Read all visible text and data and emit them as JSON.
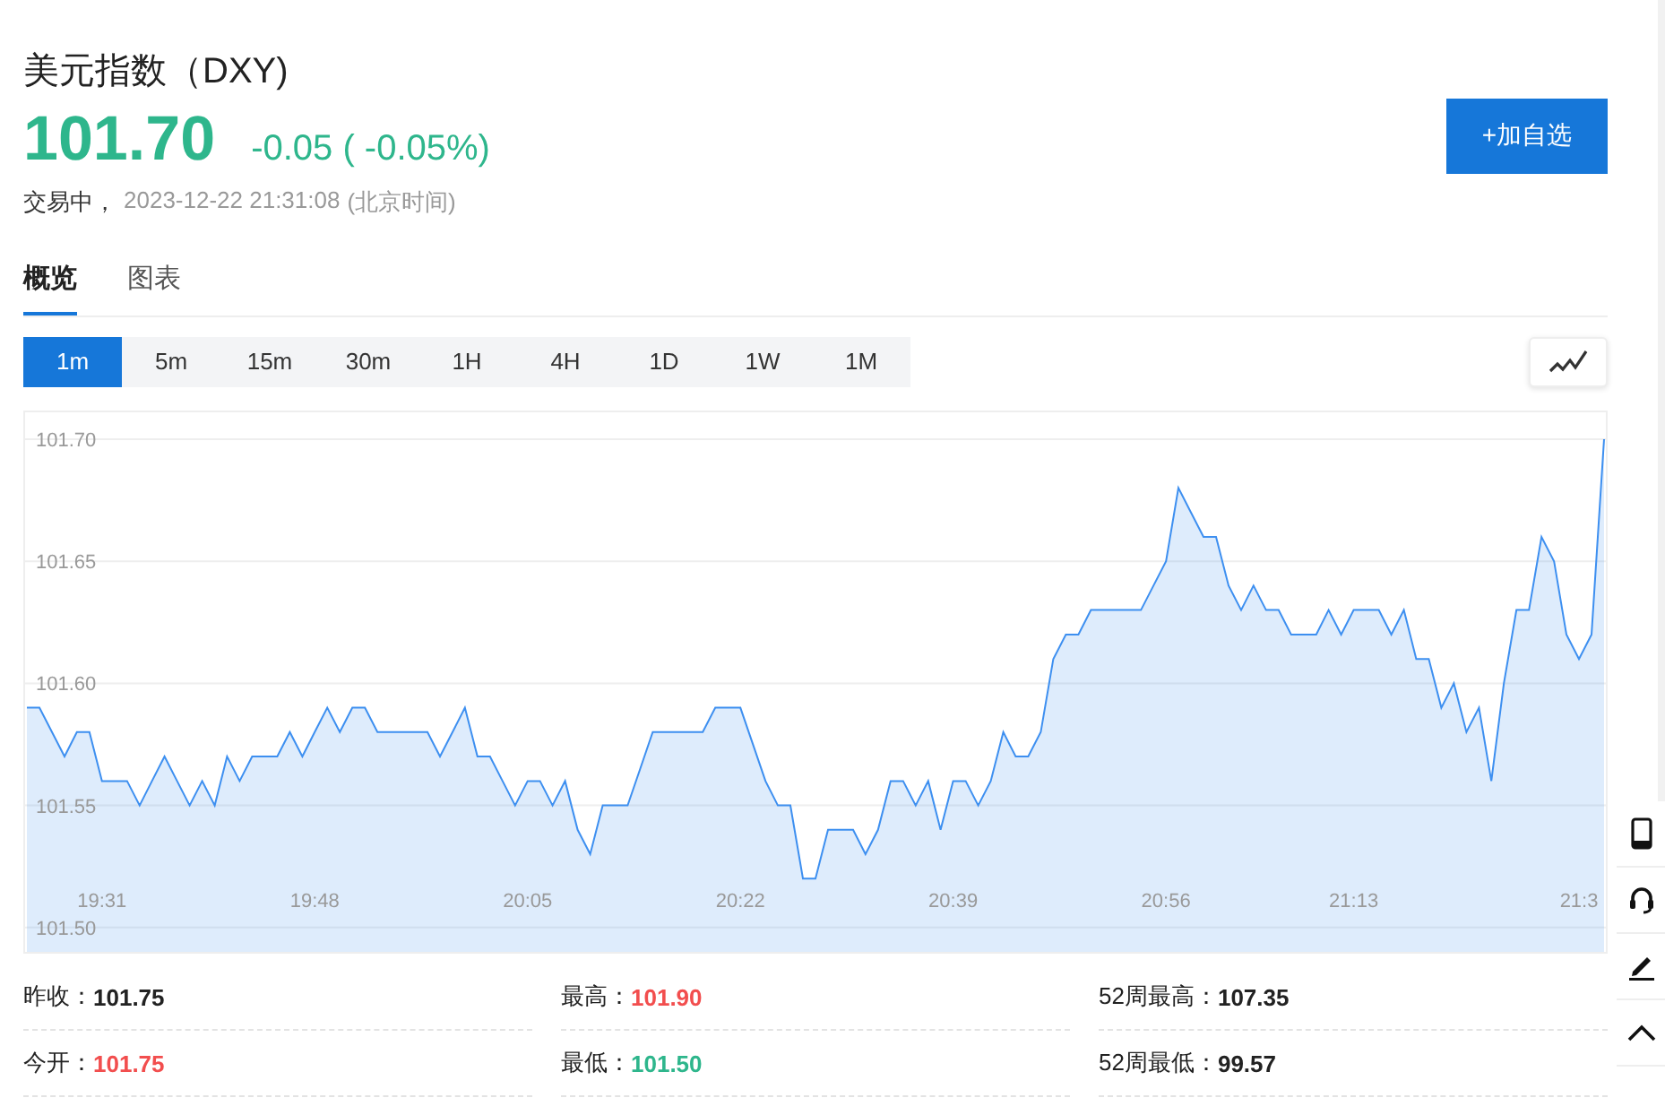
{
  "header": {
    "title": "美元指数（DXY)",
    "price": "101.70",
    "change": "-0.05 ( -0.05%)",
    "status": "交易中，",
    "time": "2023-12-22 21:31:08",
    "timezone": "(北京时间)",
    "watch_button": "+加自选"
  },
  "tabs": [
    {
      "label": "概览",
      "selected": true
    },
    {
      "label": "图表",
      "selected": false
    }
  ],
  "ranges": [
    {
      "label": "1m",
      "selected": true
    },
    {
      "label": "5m",
      "selected": false
    },
    {
      "label": "15m",
      "selected": false
    },
    {
      "label": "30m",
      "selected": false
    },
    {
      "label": "1H",
      "selected": false
    },
    {
      "label": "4H",
      "selected": false
    },
    {
      "label": "1D",
      "selected": false
    },
    {
      "label": "1W",
      "selected": false
    },
    {
      "label": "1M",
      "selected": false
    }
  ],
  "chart": {
    "chart_data": {
      "type": "area",
      "categories": [
        null,
        null,
        null,
        null,
        null,
        null,
        "19:31",
        null,
        null,
        null,
        null,
        null,
        null,
        null,
        null,
        null,
        null,
        null,
        null,
        null,
        null,
        null,
        null,
        "19:48",
        null,
        null,
        null,
        null,
        null,
        null,
        null,
        null,
        null,
        null,
        null,
        null,
        null,
        null,
        null,
        null,
        "20:05",
        null,
        null,
        null,
        null,
        null,
        null,
        null,
        null,
        null,
        null,
        null,
        null,
        null,
        null,
        null,
        null,
        "20:22",
        null,
        null,
        null,
        null,
        null,
        null,
        null,
        null,
        null,
        null,
        null,
        null,
        null,
        null,
        null,
        null,
        "20:39",
        null,
        null,
        null,
        null,
        null,
        null,
        null,
        null,
        null,
        null,
        null,
        null,
        null,
        null,
        null,
        null,
        "20:56",
        null,
        null,
        null,
        null,
        null,
        null,
        null,
        null,
        null,
        null,
        null,
        null,
        null,
        null,
        "21:13",
        null,
        null,
        null,
        null,
        null,
        null,
        null,
        null,
        null,
        null,
        null,
        null,
        null,
        null,
        null,
        null,
        null,
        "21:3",
        null,
        null
      ],
      "series": [
        {
          "color": "#3d8ff0",
          "values": [
            101.59,
            101.59,
            101.58,
            101.57,
            101.58,
            101.58,
            101.56,
            101.56,
            101.56,
            101.55,
            101.56,
            101.57,
            101.56,
            101.55,
            101.56,
            101.55,
            101.57,
            101.56,
            101.57,
            101.57,
            101.57,
            101.58,
            101.57,
            101.58,
            101.59,
            101.58,
            101.59,
            101.59,
            101.58,
            101.58,
            101.58,
            101.58,
            101.58,
            101.57,
            101.58,
            101.59,
            101.57,
            101.57,
            101.56,
            101.55,
            101.56,
            101.56,
            101.55,
            101.56,
            101.54,
            101.53,
            101.55,
            101.55,
            101.55,
            101.565,
            101.58,
            101.58,
            101.58,
            101.58,
            101.58,
            101.59,
            101.59,
            101.59,
            101.575,
            101.56,
            101.55,
            101.55,
            101.52,
            101.52,
            101.54,
            101.54,
            101.54,
            101.53,
            101.54,
            101.56,
            101.56,
            101.55,
            101.56,
            101.54,
            101.56,
            101.56,
            101.55,
            101.56,
            101.58,
            101.57,
            101.57,
            101.58,
            101.61,
            101.62,
            101.62,
            101.63,
            101.63,
            101.63,
            101.63,
            101.63,
            101.64,
            101.65,
            101.68,
            101.67,
            101.66,
            101.66,
            101.64,
            101.63,
            101.64,
            101.63,
            101.63,
            101.62,
            101.62,
            101.62,
            101.63,
            101.62,
            101.63,
            101.63,
            101.63,
            101.62,
            101.63,
            101.61,
            101.61,
            101.59,
            101.6,
            101.58,
            101.59,
            101.56,
            101.6,
            101.63,
            101.63,
            101.66,
            101.65,
            101.62,
            101.61,
            101.62,
            101.7
          ]
        }
      ],
      "ylim": [
        101.49,
        101.7
      ],
      "grid": true,
      "yticks": [
        {
          "value": 101.7,
          "label": "101.70"
        },
        {
          "value": 101.65,
          "label": "101.65"
        },
        {
          "value": 101.6,
          "label": "101.60"
        },
        {
          "value": 101.55,
          "label": "101.55"
        },
        {
          "value": 101.5,
          "label": "101.50"
        }
      ]
    }
  },
  "stats": [
    {
      "label": "昨收：",
      "value": "101.75",
      "color": "#222222"
    },
    {
      "label": "最高：",
      "value": "101.90",
      "color": "#f24e4e"
    },
    {
      "label": "52周最高：",
      "value": "107.35",
      "color": "#222222"
    },
    {
      "label": "今开：",
      "value": "101.75",
      "color": "#f24e4e"
    },
    {
      "label": "最低：",
      "value": "101.50",
      "color": "#2eb68c"
    },
    {
      "label": "52周最低：",
      "value": "99.57",
      "color": "#222222"
    }
  ]
}
